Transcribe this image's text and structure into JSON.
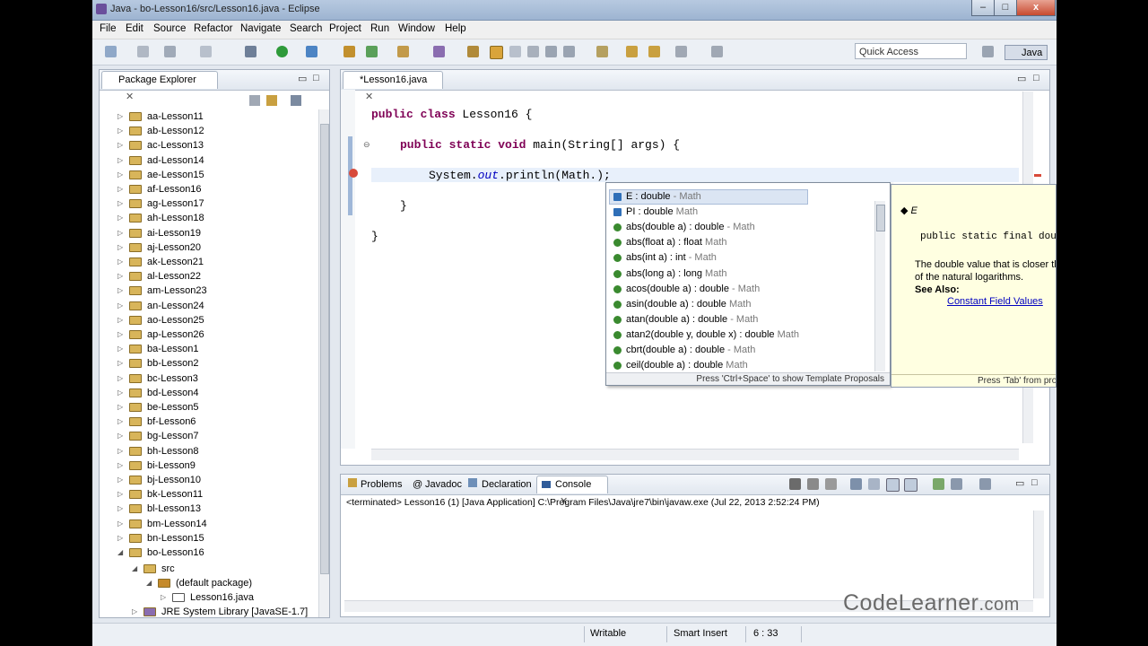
{
  "window": {
    "title": "Java - bo-Lesson16/src/Lesson16.java - Eclipse",
    "min_label": "–",
    "max_label": "□",
    "close_label": "x"
  },
  "menu": [
    "File",
    "Edit",
    "Source",
    "Refactor",
    "Navigate",
    "Search",
    "Project",
    "Run",
    "Window",
    "Help"
  ],
  "toolbar": {
    "quick_access_placeholder": "Quick Access",
    "perspective_label": "Java"
  },
  "package_explorer": {
    "title": "Package Explorer",
    "projects": [
      "aa-Lesson11",
      "ab-Lesson12",
      "ac-Lesson13",
      "ad-Lesson14",
      "ae-Lesson15",
      "af-Lesson16",
      "ag-Lesson17",
      "ah-Lesson18",
      "ai-Lesson19",
      "aj-Lesson20",
      "ak-Lesson21",
      "al-Lesson22",
      "am-Lesson23",
      "an-Lesson24",
      "ao-Lesson25",
      "ap-Lesson26",
      "ba-Lesson1",
      "bb-Lesson2",
      "bc-Lesson3",
      "bd-Lesson4",
      "be-Lesson5",
      "bf-Lesson6",
      "bg-Lesson7",
      "bh-Lesson8",
      "bi-Lesson9",
      "bj-Lesson10",
      "bk-Lesson11",
      "bl-Lesson13",
      "bm-Lesson14",
      "bn-Lesson15",
      "bo-Lesson16"
    ],
    "src_label": "src",
    "default_package_label": "(default package)",
    "file_label": "Lesson16.java",
    "jre_label": "JRE System Library [JavaSE-1.7]"
  },
  "editor": {
    "tab_label": "*Lesson16.java",
    "code": {
      "l1_kw": "public class",
      "l1_rest": " Lesson16 {",
      "l2_kw": "public static void",
      "l2_rest": " main(String[] args) {",
      "l3_a": "System.",
      "l3_out": "out",
      "l3_b": ".println(Math.);",
      "l4": "}",
      "l5": "}"
    }
  },
  "content_assist": {
    "items": [
      {
        "name": "E : double",
        "type": " - Math",
        "kind": "field"
      },
      {
        "name": "PI : double",
        "type": "  Math",
        "kind": "field"
      },
      {
        "name": "abs(double a) : double",
        "type": " - Math",
        "kind": "method"
      },
      {
        "name": "abs(float a) : float",
        "type": "  Math",
        "kind": "method"
      },
      {
        "name": "abs(int a) : int",
        "type": " - Math",
        "kind": "method"
      },
      {
        "name": "abs(long a) : long",
        "type": "  Math",
        "kind": "method"
      },
      {
        "name": "acos(double a) : double",
        "type": " - Math",
        "kind": "method"
      },
      {
        "name": "asin(double a) : double",
        "type": "  Math",
        "kind": "method"
      },
      {
        "name": "atan(double a) : double",
        "type": " - Math",
        "kind": "method"
      },
      {
        "name": "atan2(double y, double x) : double",
        "type": "  Math",
        "kind": "method"
      },
      {
        "name": "cbrt(double a) : double",
        "type": " - Math",
        "kind": "method"
      },
      {
        "name": "ceil(double a) : double",
        "type": "  Math",
        "kind": "method"
      }
    ],
    "footer": "Press 'Ctrl+Space' to show Template Proposals"
  },
  "doc_popup": {
    "symbol": "E",
    "signature": "public static final double",
    "desc1": "The double value that is closer th",
    "desc2": "of the natural logarithms.",
    "see_also": "See Also:",
    "link": "Constant Field Values",
    "footer": "Press 'Tab' from pro"
  },
  "bottom_panel": {
    "tabs": [
      "Problems",
      "Javadoc",
      "Declaration",
      "Console"
    ],
    "console_line": "<terminated> Lesson16 (1) [Java Application] C:\\Program Files\\Java\\jre7\\bin\\javaw.exe (Jul 22, 2013 2:52:24 PM)"
  },
  "status_bar": {
    "writable": "Writable",
    "insert_mode": "Smart Insert",
    "position": "6 : 33"
  },
  "watermark": {
    "brand": "CodeLearner",
    "tld": ".com"
  },
  "colors": {
    "keyword": "#7f0055",
    "field_italic": "#0000c0",
    "selection": "#dbe5f3",
    "doc_bg": "#ffffe1"
  }
}
